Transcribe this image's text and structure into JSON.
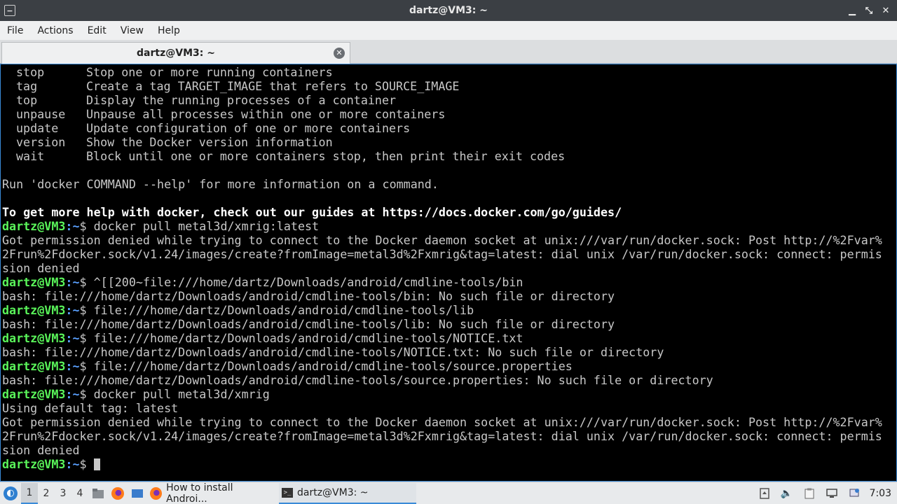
{
  "window": {
    "title": "dartz@VM3: ~",
    "minimize_glyph": "▁",
    "maximize_glyph": "⤡",
    "close_glyph": "✕"
  },
  "menubar": {
    "items": [
      "File",
      "Actions",
      "Edit",
      "View",
      "Help"
    ]
  },
  "tab": {
    "label": "dartz@VM3: ~"
  },
  "terminal": {
    "commands": [
      {
        "name": "stop",
        "desc": "Stop one or more running containers"
      },
      {
        "name": "tag",
        "desc": "Create a tag TARGET_IMAGE that refers to SOURCE_IMAGE"
      },
      {
        "name": "top",
        "desc": "Display the running processes of a container"
      },
      {
        "name": "unpause",
        "desc": "Unpause all processes within one or more containers"
      },
      {
        "name": "update",
        "desc": "Update configuration of one or more containers"
      },
      {
        "name": "version",
        "desc": "Show the Docker version information"
      },
      {
        "name": "wait",
        "desc": "Block until one or more containers stop, then print their exit codes"
      }
    ],
    "help_line": "Run 'docker COMMAND --help' for more information on a command.",
    "guides_line": "To get more help with docker, check out our guides at https://docs.docker.com/go/guides/",
    "prompt_user": "dartz@VM3",
    "prompt_path": ":~",
    "prompt_symbol": "$ ",
    "entries": [
      {
        "type": "prompt",
        "cmd": "docker pull metal3d/xmrig:latest"
      },
      {
        "type": "out",
        "text": "Got permission denied while trying to connect to the Docker daemon socket at unix:///var/run/docker.sock: Post http://%2Fvar%"
      },
      {
        "type": "out",
        "text": "2Frun%2Fdocker.sock/v1.24/images/create?fromImage=metal3d%2Fxmrig&tag=latest: dial unix /var/run/docker.sock: connect: permis"
      },
      {
        "type": "out",
        "text": "sion denied"
      },
      {
        "type": "prompt",
        "cmd": "^[[200~file:///home/dartz/Downloads/android/cmdline-tools/bin"
      },
      {
        "type": "out",
        "text": "bash: file:///home/dartz/Downloads/android/cmdline-tools/bin: No such file or directory"
      },
      {
        "type": "prompt",
        "cmd": "file:///home/dartz/Downloads/android/cmdline-tools/lib"
      },
      {
        "type": "out",
        "text": "bash: file:///home/dartz/Downloads/android/cmdline-tools/lib: No such file or directory"
      },
      {
        "type": "prompt",
        "cmd": "file:///home/dartz/Downloads/android/cmdline-tools/NOTICE.txt"
      },
      {
        "type": "out",
        "text": "bash: file:///home/dartz/Downloads/android/cmdline-tools/NOTICE.txt: No such file or directory"
      },
      {
        "type": "prompt",
        "cmd": "file:///home/dartz/Downloads/android/cmdline-tools/source.properties"
      },
      {
        "type": "out",
        "text": "bash: file:///home/dartz/Downloads/android/cmdline-tools/source.properties: No such file or directory"
      },
      {
        "type": "prompt",
        "cmd": "docker pull metal3d/xmrig"
      },
      {
        "type": "out",
        "text": "Using default tag: latest"
      },
      {
        "type": "out",
        "text": "Got permission denied while trying to connect to the Docker daemon socket at unix:///var/run/docker.sock: Post http://%2Fvar%"
      },
      {
        "type": "out",
        "text": "2Frun%2Fdocker.sock/v1.24/images/create?fromImage=metal3d%2Fxmrig&tag=latest: dial unix /var/run/docker.sock: connect: permis"
      },
      {
        "type": "out",
        "text": "sion denied"
      }
    ]
  },
  "taskbar": {
    "workspaces": [
      "1",
      "2",
      "3",
      "4"
    ],
    "active_workspace": "1",
    "tasks": [
      {
        "label": "How to install Androi...",
        "icon": "firefox-icon"
      },
      {
        "label": "dartz@VM3: ~",
        "icon": "terminal-icon"
      }
    ],
    "clock": "7:03"
  }
}
